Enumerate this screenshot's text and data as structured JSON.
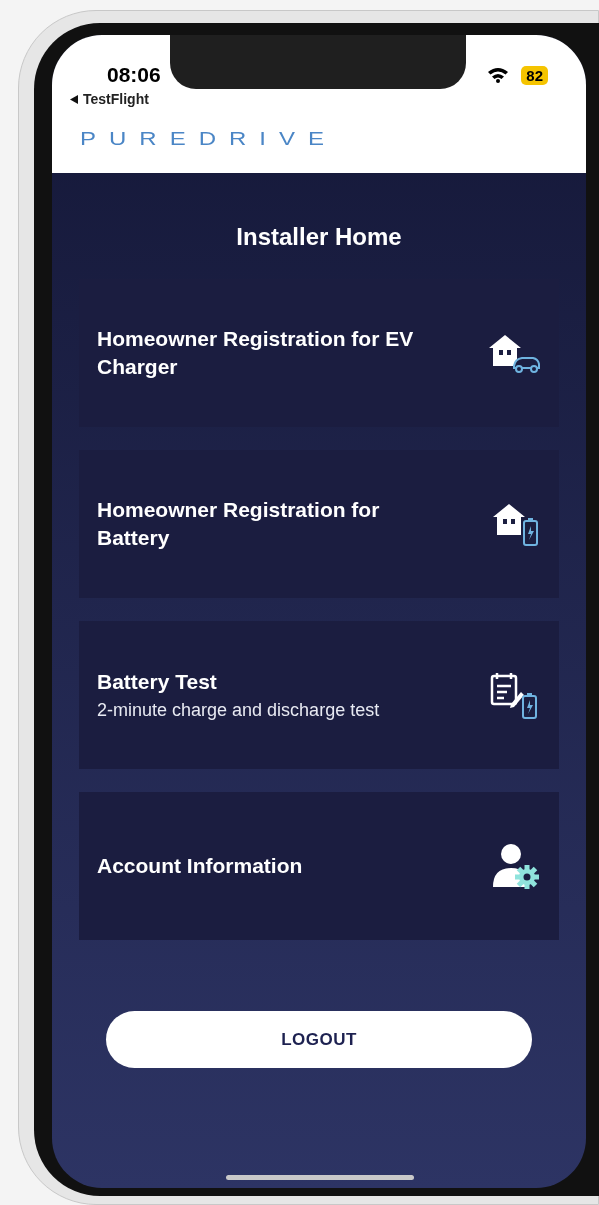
{
  "status_bar": {
    "time": "08:06",
    "back_label": "TestFlight",
    "battery": "82"
  },
  "header": {
    "logo": "PUREDRIVE"
  },
  "title": "Installer Home",
  "menu_items": [
    {
      "kind": "ev-charger",
      "title": "Homeowner Registration for EV Charger"
    },
    {
      "kind": "battery",
      "title": "Homeowner Registration for Battery"
    },
    {
      "kind": "battery-test",
      "title": "Battery Test",
      "subtitle": "2-minute charge and discharge test"
    },
    {
      "kind": "account",
      "title": "Account Information"
    }
  ],
  "logout_button": {
    "label": "LOGOUT"
  }
}
